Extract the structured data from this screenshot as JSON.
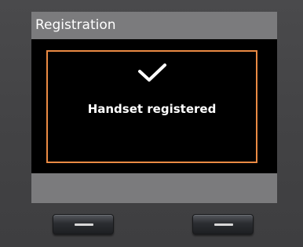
{
  "screen": {
    "title": "Registration",
    "message": "Handset registered",
    "status_icon": "checkmark-icon",
    "colors": {
      "title_bar": "#7b7b7d",
      "background": "#000000",
      "highlight_border": "#ea8a43",
      "text": "#ffffff"
    }
  },
  "softkeys": {
    "left_icon": "line-icon",
    "right_icon": "line-icon"
  }
}
